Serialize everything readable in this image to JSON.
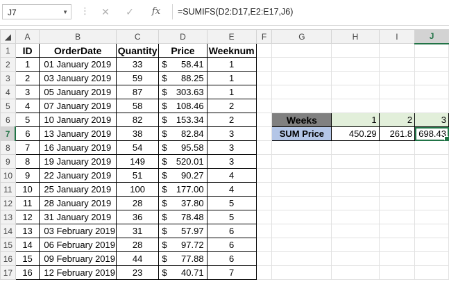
{
  "formula_bar": {
    "name_box": "J7",
    "cancel_icon": "✕",
    "enter_icon": "✓",
    "fx_icon": "fx",
    "formula": "=SUMIFS(D2:D17,E2:E17,J6)"
  },
  "columns": [
    "A",
    "B",
    "C",
    "D",
    "E",
    "F",
    "G",
    "H",
    "I",
    "J"
  ],
  "selected_column": "J",
  "selected_row": 7,
  "table": {
    "headers": [
      "ID",
      "OrderDate",
      "Quantity",
      "Price",
      "Weeknum"
    ],
    "rows": [
      {
        "id": "1",
        "date": "01 January 2019",
        "qty": "33",
        "cur": "$",
        "price": "58.41",
        "week": "1"
      },
      {
        "id": "2",
        "date": "03 January 2019",
        "qty": "59",
        "cur": "$",
        "price": "88.25",
        "week": "1"
      },
      {
        "id": "3",
        "date": "05 January 2019",
        "qty": "87",
        "cur": "$",
        "price": "303.63",
        "week": "1"
      },
      {
        "id": "4",
        "date": "07 January 2019",
        "qty": "58",
        "cur": "$",
        "price": "108.46",
        "week": "2"
      },
      {
        "id": "5",
        "date": "10 January 2019",
        "qty": "82",
        "cur": "$",
        "price": "153.34",
        "week": "2"
      },
      {
        "id": "6",
        "date": "13 January 2019",
        "qty": "38",
        "cur": "$",
        "price": "82.84",
        "week": "3"
      },
      {
        "id": "7",
        "date": "16 January 2019",
        "qty": "54",
        "cur": "$",
        "price": "95.58",
        "week": "3"
      },
      {
        "id": "8",
        "date": "19 January 2019",
        "qty": "149",
        "cur": "$",
        "price": "520.01",
        "week": "3"
      },
      {
        "id": "9",
        "date": "22 January 2019",
        "qty": "51",
        "cur": "$",
        "price": "90.27",
        "week": "4"
      },
      {
        "id": "10",
        "date": "25 January 2019",
        "qty": "100",
        "cur": "$",
        "price": "177.00",
        "week": "4"
      },
      {
        "id": "11",
        "date": "28 January 2019",
        "qty": "28",
        "cur": "$",
        "price": "37.80",
        "week": "5"
      },
      {
        "id": "12",
        "date": "31 January 2019",
        "qty": "36",
        "cur": "$",
        "price": "78.48",
        "week": "5"
      },
      {
        "id": "13",
        "date": "03 February 2019",
        "qty": "31",
        "cur": "$",
        "price": "57.97",
        "week": "6"
      },
      {
        "id": "14",
        "date": "06 February 2019",
        "qty": "28",
        "cur": "$",
        "price": "97.72",
        "week": "6"
      },
      {
        "id": "15",
        "date": "09 February 2019",
        "qty": "44",
        "cur": "$",
        "price": "77.88",
        "week": "6"
      },
      {
        "id": "16",
        "date": "12 February 2019",
        "qty": "23",
        "cur": "$",
        "price": "40.71",
        "week": "7"
      }
    ]
  },
  "summary": {
    "weeks_label": "Weeks",
    "weeks": [
      "1",
      "2",
      "3"
    ],
    "sum_label": "SUM Price",
    "sums": [
      "450.29",
      "261.8",
      "698.43"
    ]
  },
  "colors": {
    "accent": "#217346",
    "weeks_label_bg": "#808080",
    "weeks_value_bg": "#e2efda",
    "sum_label_bg": "#b4c6e7"
  }
}
